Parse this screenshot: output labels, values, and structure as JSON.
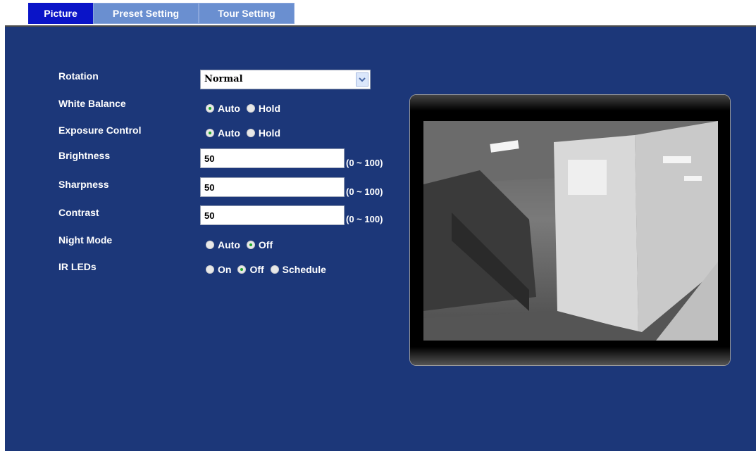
{
  "tabs": [
    {
      "label": "Picture",
      "active": true
    },
    {
      "label": "Preset Setting",
      "active": false
    },
    {
      "label": "Tour Setting",
      "active": false
    }
  ],
  "form": {
    "rotation": {
      "label": "Rotation",
      "value": "Normal"
    },
    "white_balance": {
      "label": "White Balance",
      "options": [
        "Auto",
        "Hold"
      ],
      "selected": "Auto"
    },
    "exposure_control": {
      "label": "Exposure Control",
      "options": [
        "Auto",
        "Hold"
      ],
      "selected": "Auto"
    },
    "brightness": {
      "label": "Brightness",
      "value": "50",
      "range": "(0 ~ 100)"
    },
    "sharpness": {
      "label": "Sharpness",
      "value": "50",
      "range": "(0 ~ 100)"
    },
    "contrast": {
      "label": "Contrast",
      "value": "50",
      "range": "(0 ~ 100)"
    },
    "night_mode": {
      "label": "Night Mode",
      "options": [
        "Auto",
        "Off"
      ],
      "selected": "Off"
    },
    "ir_leds": {
      "label": "IR LEDs",
      "options": [
        "On",
        "Off",
        "Schedule"
      ],
      "selected": "Off"
    }
  },
  "colors": {
    "panel_bg": "#1c3779",
    "active_tab": "#0a14c8",
    "inactive_tab": "#6a8fd0",
    "radio_selected": "#1fa82a"
  },
  "icons": {
    "select_arrow": "chevron-down-icon",
    "video": "camera-video-preview"
  }
}
